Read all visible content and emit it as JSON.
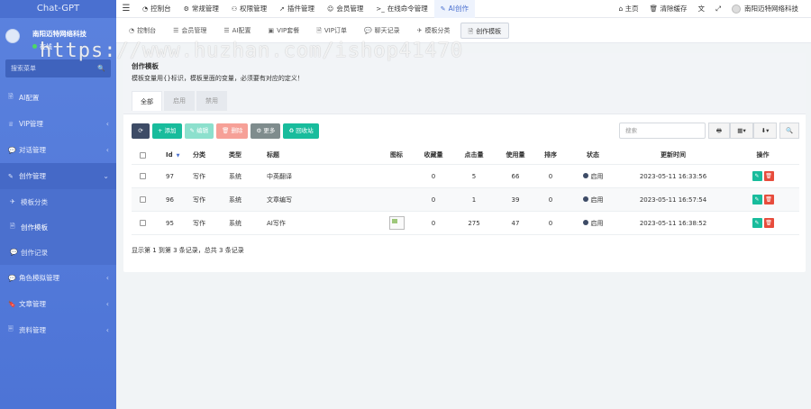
{
  "sidebar": {
    "brand": "Chat-GPT",
    "user_name": "南阳迈特网络科技",
    "user_status": "在线",
    "search_placeholder": "搜索菜单",
    "items": [
      {
        "label": "AI配置",
        "icon": "🗟"
      },
      {
        "label": "VIP管理",
        "icon": "♕"
      },
      {
        "label": "对话管理",
        "icon": "💬"
      },
      {
        "label": "创作管理",
        "icon": "✎",
        "open": true
      }
    ],
    "subitems": [
      {
        "label": "模板分类",
        "icon": "✈"
      },
      {
        "label": "创作模板",
        "icon": "🗎"
      },
      {
        "label": "创作记录",
        "icon": "💬"
      }
    ],
    "items_after": [
      {
        "label": "角色模拟管理",
        "icon": "💬"
      },
      {
        "label": "文章管理",
        "icon": "🔖"
      },
      {
        "label": "资料管理",
        "icon": "🗏"
      }
    ]
  },
  "topbar": {
    "nav": [
      {
        "label": "控制台",
        "icon": "◔"
      },
      {
        "label": "常规管理",
        "icon": "⚙"
      },
      {
        "label": "权限管理",
        "icon": "⚇"
      },
      {
        "label": "插件管理",
        "icon": "➚"
      },
      {
        "label": "会员管理",
        "icon": "☺"
      },
      {
        "label": "在线命令管理",
        "icon": ">_"
      },
      {
        "label": "AI创作",
        "icon": "✎",
        "active": true
      }
    ],
    "home": "主页",
    "clear_cache": "清除缓存",
    "translate_icon": "文",
    "fullscreen_icon": "⤢",
    "user_name": "南阳迈特网络科技"
  },
  "tabbar": [
    {
      "label": "控制台",
      "icon": "◔"
    },
    {
      "label": "会员管理",
      "icon": "☰"
    },
    {
      "label": "AI配置",
      "icon": "☰"
    },
    {
      "label": "VIP套餐",
      "icon": "▣"
    },
    {
      "label": "VIP订单",
      "icon": "🗎"
    },
    {
      "label": "聊天记录",
      "icon": "💬"
    },
    {
      "label": "模板分类",
      "icon": "✈"
    },
    {
      "label": "创作模板",
      "icon": "🗎",
      "active": true
    }
  ],
  "watermark": "https://www.huzhan.com/ishop41470",
  "page": {
    "title": "创作模板",
    "description": "模板变量用{}标识，模板里面的变量，必须要有对应的定义！",
    "tabs": [
      "全部",
      "启用",
      "禁用"
    ]
  },
  "toolbar": {
    "refresh_icon": "⟳",
    "add": "添加",
    "edit": "编辑",
    "delete": "删除",
    "more": "更多",
    "recycle": "回收站",
    "search_placeholder": "搜索",
    "add_icon": "+",
    "edit_icon": "✎",
    "delete_icon": "🗑",
    "more_icon": "⚙",
    "recycle_icon": "♻",
    "print_icon": "🖶",
    "columns_icon": "▦",
    "export_icon": "⬇",
    "search_icon": "🔍"
  },
  "table": {
    "headers": {
      "id": "Id",
      "category": "分类",
      "type": "类型",
      "title": "标题",
      "icon": "图标",
      "favorites": "收藏量",
      "clicks": "点击量",
      "usage": "使用量",
      "sort": "排序",
      "status": "状态",
      "updated": "更新时间",
      "operation": "操作"
    },
    "rows": [
      {
        "id": "97",
        "category": "写作",
        "type": "系统",
        "title": "中英翻译",
        "has_icon": false,
        "favorites": "0",
        "clicks": "5",
        "usage": "66",
        "sort": "0",
        "status": "启用",
        "updated": "2023-05-11 16:33:56"
      },
      {
        "id": "96",
        "category": "写作",
        "type": "系统",
        "title": "文章编写",
        "has_icon": false,
        "favorites": "0",
        "clicks": "1",
        "usage": "39",
        "sort": "0",
        "status": "启用",
        "updated": "2023-05-11 16:57:54"
      },
      {
        "id": "95",
        "category": "写作",
        "type": "系统",
        "title": "AI写作",
        "has_icon": true,
        "favorites": "0",
        "clicks": "275",
        "usage": "47",
        "sort": "0",
        "status": "启用",
        "updated": "2023-05-11 16:38:52"
      }
    ],
    "summary": "显示第 1 到第 3 条记录，总共 3 条记录"
  }
}
